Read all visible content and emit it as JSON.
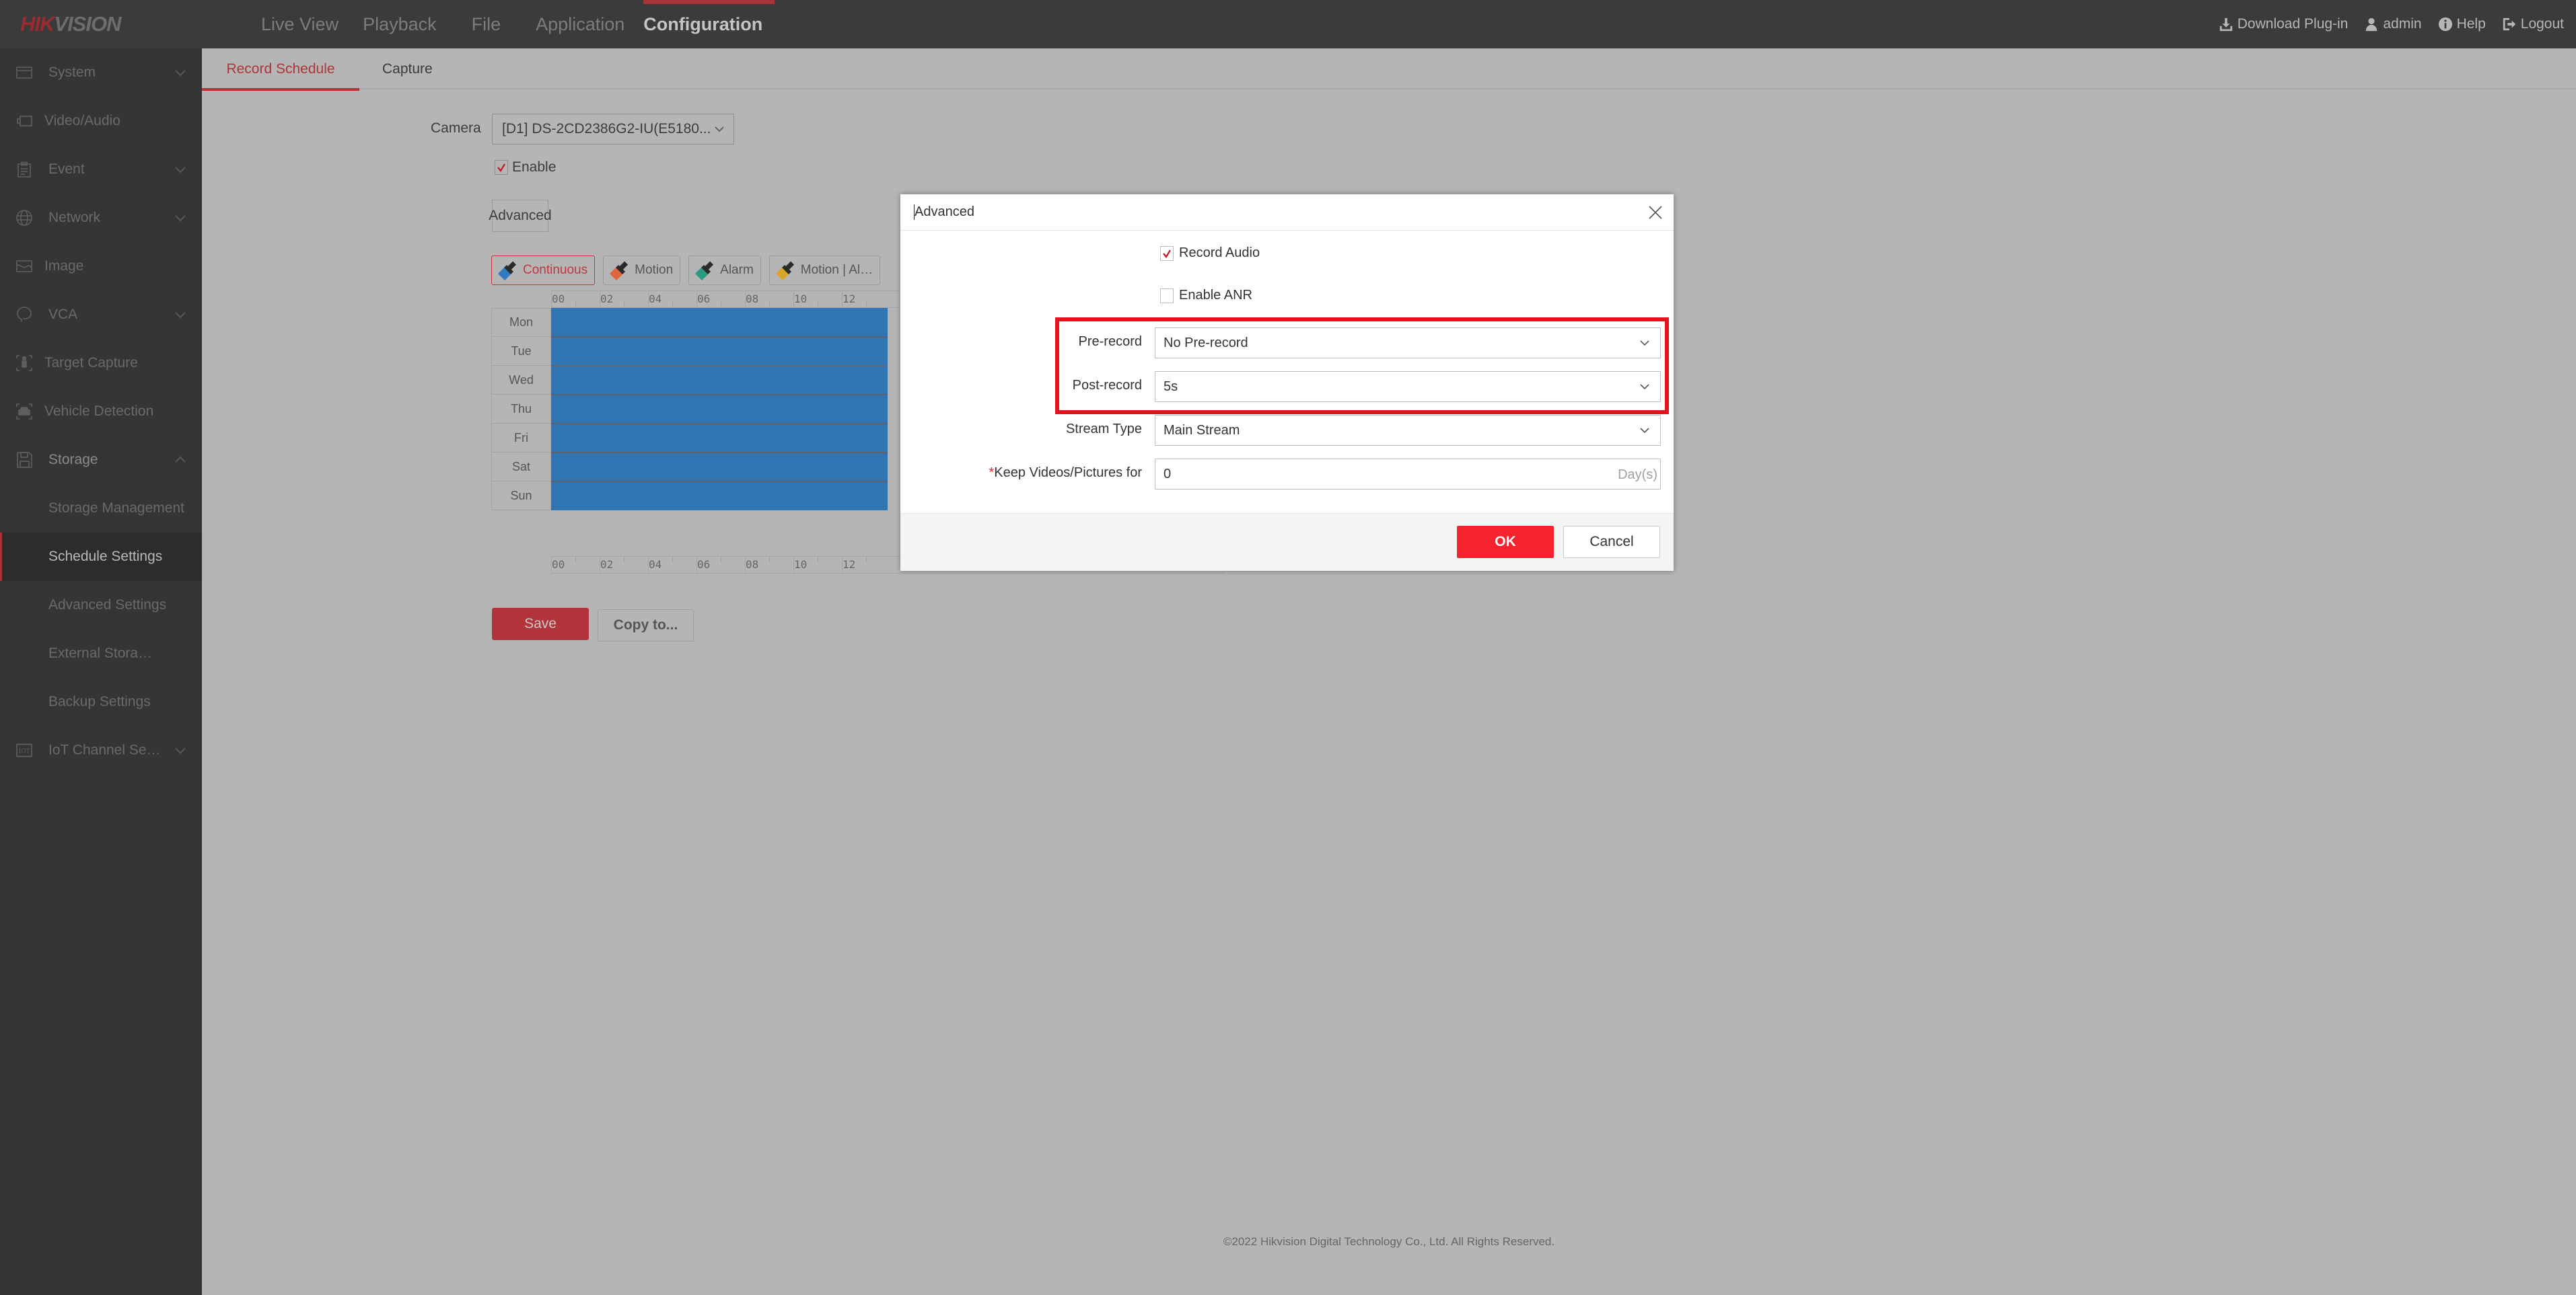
{
  "brand": {
    "hik": "HIK",
    "vision": "VISION"
  },
  "nav": {
    "items": [
      {
        "label": "Live View"
      },
      {
        "label": "Playback"
      },
      {
        "label": "File"
      },
      {
        "label": "Application"
      },
      {
        "label": "Configuration",
        "active": true
      }
    ]
  },
  "topright": {
    "download": "Download Plug-in",
    "user": "admin",
    "help": "Help",
    "logout": "Logout"
  },
  "sidebar": {
    "items": [
      {
        "label": "System",
        "icon": "window-icon",
        "expandable": true
      },
      {
        "label": "Video/Audio",
        "icon": "camera-icon"
      },
      {
        "label": "Event",
        "icon": "clipboard-icon",
        "expandable": true
      },
      {
        "label": "Network",
        "icon": "globe-icon",
        "expandable": true
      },
      {
        "label": "Image",
        "icon": "image-icon"
      },
      {
        "label": "VCA",
        "icon": "head-icon",
        "expandable": true
      },
      {
        "label": "Target Capture",
        "icon": "person-target-icon"
      },
      {
        "label": "Vehicle Detection",
        "icon": "car-target-icon"
      },
      {
        "label": "Storage",
        "icon": "floppy-icon",
        "expanded": true
      },
      {
        "label": "IoT Channel Se…",
        "icon": "iot-icon",
        "expandable": true
      }
    ],
    "storage_sub": [
      {
        "label": "Storage Management"
      },
      {
        "label": "Schedule Settings",
        "active": true
      },
      {
        "label": "Advanced Settings"
      },
      {
        "label": "External Stora…"
      },
      {
        "label": "Backup Settings"
      }
    ]
  },
  "tabs": [
    {
      "label": "Record Schedule",
      "active": true
    },
    {
      "label": "Capture"
    }
  ],
  "form": {
    "camera_label": "Camera",
    "camera_value": "[D1] DS-2CD2386G2-IU(E5180...",
    "enable_label": "Enable",
    "enable_checked": true,
    "advanced_button": "Advanced"
  },
  "brushes": [
    {
      "label": "Continuous",
      "color": "#2f7bc0",
      "active": true
    },
    {
      "label": "Motion",
      "color": "#e0643c"
    },
    {
      "label": "Alarm",
      "color": "#2a9a82"
    },
    {
      "label": "Motion | Al…",
      "color": "#d8a52a"
    }
  ],
  "schedule": {
    "days": [
      "Mon",
      "Tue",
      "Wed",
      "Thu",
      "Fri",
      "Sat",
      "Sun"
    ],
    "hour_labels": [
      "00",
      "02",
      "04",
      "06",
      "08",
      "10",
      "12"
    ],
    "fill_color": "#3176b3",
    "mode": "Continuous"
  },
  "actions": {
    "save": "Save",
    "copy": "Copy to..."
  },
  "footer": "©2022 Hikvision Digital Technology Co., Ltd. All Rights Reserved.",
  "modal": {
    "title": "Advanced",
    "record_audio_label": "Record Audio",
    "record_audio_checked": true,
    "enable_anr_label": "Enable ANR",
    "enable_anr_checked": false,
    "prerecord_label": "Pre-record",
    "prerecord_value": "No Pre-record",
    "postrecord_label": "Post-record",
    "postrecord_value": "5s",
    "stream_label": "Stream Type",
    "stream_value": "Main Stream",
    "keep_required_mark": "*",
    "keep_label": "Keep Videos/Pictures for",
    "keep_value": "0",
    "keep_unit": "Day(s)",
    "ok": "OK",
    "cancel": "Cancel"
  }
}
